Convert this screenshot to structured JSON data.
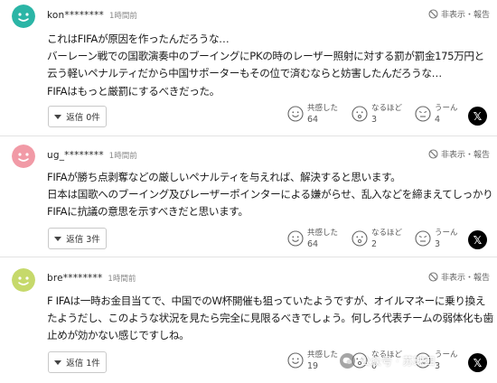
{
  "ui": {
    "report_label": "非表示・報告",
    "reaction_labels": [
      "共感した",
      "なるほど",
      "うーん"
    ]
  },
  "comments": [
    {
      "username": "kon********",
      "time": "1時間前",
      "avatar_color": "#2bb5a6",
      "body": "これはFIFAが原因を作ったんだろうな…\nバーレーン戦での国歌演奏中のブーイングにPKの時のレーザー照射に対する罰が罰金175万円と云う軽いペナルティだから中国サポーターもその位で済むならと妨害したんだろうな…\nFIFAはもっと厳罰にするべきだった。",
      "reply_label": "返信 0件",
      "counts": [
        "64",
        "3",
        "4"
      ]
    },
    {
      "username": "ug_********",
      "time": "1時間前",
      "avatar_color": "#f19aa6",
      "body": "FIFAが勝ち点剥奪などの厳しいペナルティを与えれば、解決すると思います。\n日本は国歌へのブーイング及びレーザーポインターによる嫌がらせ、乱入などを締まえてしっかりFIFAに抗議の意思を示すべきだと思います。",
      "reply_label": "返信 3件",
      "counts": [
        "64",
        "2",
        "3"
      ]
    },
    {
      "username": "bre********",
      "time": "1時間前",
      "avatar_color": "#c6d96b",
      "body": "F IFAは一時お金目当てで、中国でのW杯開催も狙っていたようですが、オイルマネーに乗り換えたようだし、このような状況を見たら完全に見限るべきでしょう。何しろ代表チームの弱体化も歯止めが効かない感じですしね。",
      "reply_label": "返信 1件",
      "counts": [
        "19",
        "0",
        "3"
      ]
    }
  ],
  "watermark": {
    "text": "公众号 · 苏球四"
  }
}
